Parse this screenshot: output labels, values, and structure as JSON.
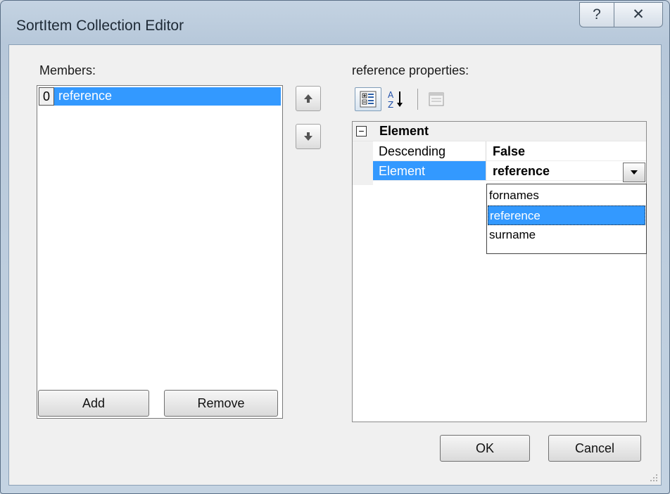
{
  "window": {
    "title": "SortItem Collection Editor",
    "help_glyph": "?",
    "close_glyph": "✕"
  },
  "members": {
    "label": "Members:",
    "items": [
      {
        "index": "0",
        "text": "reference"
      }
    ]
  },
  "properties": {
    "label": "reference properties:",
    "category": "Element",
    "expander_glyph": "⊟",
    "rows": [
      {
        "name": "Descending",
        "value": "False"
      },
      {
        "name": "Element",
        "value": "reference"
      }
    ],
    "dropdown_options": [
      "fornames",
      "reference",
      "surname"
    ],
    "dropdown_selected": "reference"
  },
  "buttons": {
    "add": "Add",
    "remove": "Remove",
    "ok": "OK",
    "cancel": "Cancel"
  },
  "icons": {
    "move_up": "arrow-up-icon",
    "move_down": "arrow-down-icon",
    "categorized": "categorized-view-icon",
    "alphabetical": "alphabetical-sort-icon",
    "property_pages": "property-pages-icon"
  },
  "colors": {
    "selection": "#3399ff",
    "client_bg": "#f0f0f0"
  }
}
